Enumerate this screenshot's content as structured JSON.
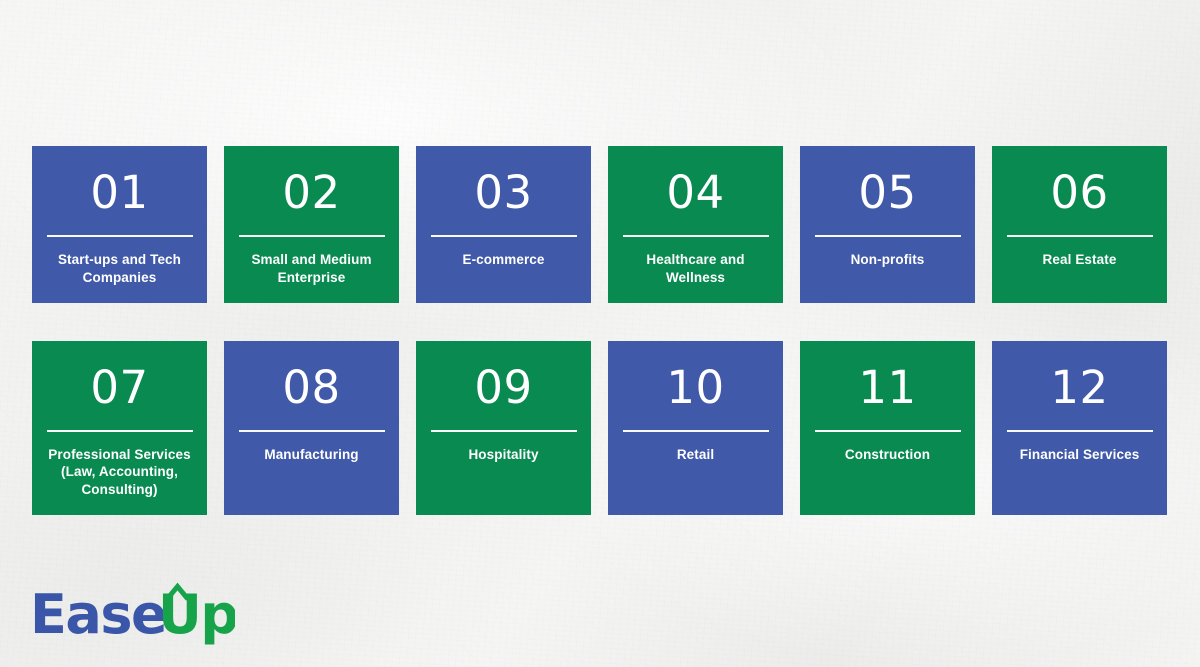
{
  "slide": {
    "background_color": "#f3f3f2",
    "accent_blue": "#4059a8",
    "accent_green": "#088a51",
    "text_color": "#ffffff"
  },
  "cards": [
    {
      "number": "01",
      "label": "Start-ups and Tech Companies",
      "color": "blue",
      "hex": "#4059a8"
    },
    {
      "number": "02",
      "label": "Small and Medium Enterprise",
      "color": "green",
      "hex": "#088a51"
    },
    {
      "number": "03",
      "label": "E-commerce",
      "color": "blue",
      "hex": "#4059a8"
    },
    {
      "number": "04",
      "label": "Healthcare and Wellness",
      "color": "green",
      "hex": "#088a51"
    },
    {
      "number": "05",
      "label": "Non-profits",
      "color": "blue",
      "hex": "#4059a8"
    },
    {
      "number": "06",
      "label": "Real Estate",
      "color": "green",
      "hex": "#088a51"
    },
    {
      "number": "07",
      "label": "Professional Services (Law, Accounting, Consulting)",
      "color": "green",
      "hex": "#088a51"
    },
    {
      "number": "08",
      "label": "Manufacturing",
      "color": "blue",
      "hex": "#4059a8"
    },
    {
      "number": "09",
      "label": "Hospitality",
      "color": "green",
      "hex": "#088a51"
    },
    {
      "number": "10",
      "label": "Retail",
      "color": "blue",
      "hex": "#4059a8"
    },
    {
      "number": "11",
      "label": "Construction",
      "color": "green",
      "hex": "#088a51"
    },
    {
      "number": "12",
      "label": "Financial Services",
      "color": "blue",
      "hex": "#4059a8"
    }
  ],
  "logo": {
    "text_primary": "Ease",
    "text_secondary": "Up",
    "full_text": "EaseUp",
    "primary_color": "#3a56a8",
    "secondary_color": "#16a34a",
    "mark": "up-arrow-caret-over-u"
  }
}
